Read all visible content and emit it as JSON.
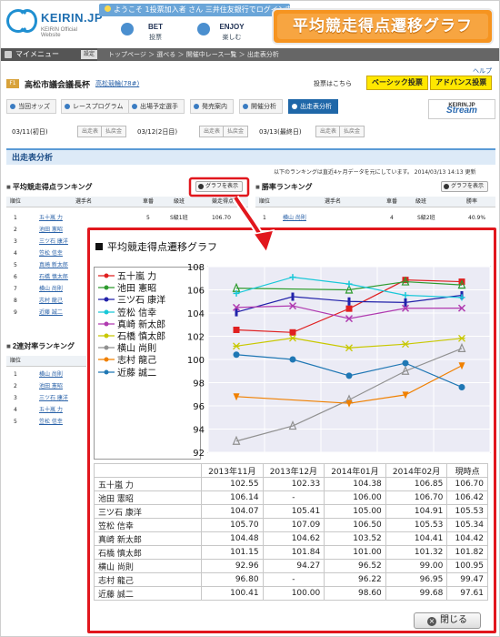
{
  "header": {
    "logo_text": "KEIRIN.JP",
    "logo_sub": "KEIRIN Official Website",
    "welcome": "ようこそ 1投票加入者 さん 三井住友銀行でログイン中",
    "nav": [
      {
        "t1": "BET",
        "t2": "投票"
      },
      {
        "t1": "ENJOY",
        "t2": "楽しむ"
      }
    ],
    "badge": "平均競走得点遷移グラフ"
  },
  "menubar": {
    "mypage": "マイメニュー",
    "settings": "設定",
    "breadcrumb": "トップページ ＞ 選べる ＞ 開催中レース一覧 ＞ 出走表分析"
  },
  "venue": {
    "name": "高松市議会議長杯",
    "trophy": "高松競輪(78#)",
    "help": "ヘルプ",
    "vote_label": "投票はこちら",
    "basic_vote": "ベーシック投票",
    "advance_vote": "アドバンス投票"
  },
  "tabs": [
    "当回オッズ",
    "レースプログラム",
    "出場予定選手",
    "発売案内",
    "開催分析",
    "出走表分析"
  ],
  "stream": {
    "top": "KEIRIN.JP",
    "label": "Stream"
  },
  "dates": [
    {
      "label": "03/11(初日)",
      "b1": "出走表",
      "b2": "払戻金"
    },
    {
      "label": "03/12(2日目)",
      "b1": "出走表",
      "b2": "払戻金"
    },
    {
      "label": "03/13(最終日)",
      "b1": "出走表",
      "b2": "払戻金"
    }
  ],
  "section_title": "出走表分析",
  "info_text": "以下のランキングは直近4ヶ月データを元にしています。 2014/03/13 14:13 更新",
  "ranking_avg": {
    "title": "平均競走得点ランキング",
    "graph_btn": "グラフを表示",
    "headers": [
      "順位",
      "選手名",
      "車番",
      "級班",
      "競走得点"
    ],
    "row1": {
      "rank": "1",
      "name": "五十嵐 力",
      "car": "5",
      "cls": "S級1班",
      "score": "106.70"
    },
    "names": [
      "池田 憲昭",
      "三ツ石 康洋",
      "笠松 信幸",
      "真崎 新太郎",
      "石橋 慎太郎",
      "横山 尚則",
      "志村 龍己",
      "近藤 誠二"
    ],
    "ranks": [
      "2",
      "3",
      "4",
      "5",
      "6",
      "7",
      "8",
      "9"
    ]
  },
  "ranking_win": {
    "title": "勝率ランキング",
    "graph_btn": "グラフを表示",
    "headers": [
      "順位",
      "選手名",
      "車番",
      "級班",
      "勝率"
    ],
    "row1": {
      "rank": "1",
      "name": "横山 尚則",
      "car": "4",
      "cls": "S級2班",
      "rate": "40.9%"
    }
  },
  "ranking_quinella": {
    "title": "2連対率ランキング",
    "names": [
      "横山 尚則",
      "池田 憲昭",
      "三ツ石 康洋",
      "五十嵐 力",
      "笠松 信幸"
    ],
    "ranks": [
      "1",
      "2",
      "3",
      "4",
      "5"
    ]
  },
  "popup": {
    "title": "平均競走得点遷移グラフ",
    "close": "閉じる"
  },
  "chart_data": {
    "type": "line",
    "title": "平均競走得点遷移グラフ",
    "categories": [
      "2013年11月",
      "2013年12月",
      "2014年01月",
      "2014年02月",
      "現時点"
    ],
    "ylim": [
      92,
      108
    ],
    "yticks": [
      92,
      94,
      96,
      98,
      100,
      102,
      104,
      106,
      108
    ],
    "grid": true,
    "legend": "left",
    "series": [
      {
        "name": "五十嵐 力",
        "color": "#e02020",
        "marker": "square",
        "values": [
          102.55,
          102.33,
          104.38,
          106.85,
          106.7
        ],
        "labels": [
          "102.55",
          "102.33",
          "104.38",
          "106.85",
          "106.70"
        ]
      },
      {
        "name": "池田 憲昭",
        "color": "#2e9b2e",
        "marker": "triangle",
        "values": [
          106.14,
          null,
          106.0,
          106.7,
          106.42
        ],
        "labels": [
          "106.14",
          "-",
          "106.00",
          "106.70",
          "106.42"
        ]
      },
      {
        "name": "三ツ石 康洋",
        "color": "#2222aa",
        "marker": "bar",
        "values": [
          104.07,
          105.41,
          105.0,
          104.91,
          105.53
        ],
        "labels": [
          "104.07",
          "105.41",
          "105.00",
          "104.91",
          "105.53"
        ]
      },
      {
        "name": "笠松 信幸",
        "color": "#18c8d8",
        "marker": "plus",
        "values": [
          105.7,
          107.09,
          106.5,
          105.53,
          105.34
        ],
        "labels": [
          "105.70",
          "107.09",
          "106.50",
          "105.53",
          "105.34"
        ]
      },
      {
        "name": "真崎 新太郎",
        "color": "#b03ab0",
        "marker": "x",
        "values": [
          104.48,
          104.62,
          103.52,
          104.41,
          104.42
        ],
        "labels": [
          "104.48",
          "104.62",
          "103.52",
          "104.41",
          "104.42"
        ]
      },
      {
        "name": "石橋 慎太郎",
        "color": "#c8c800",
        "marker": "asterisk",
        "values": [
          101.15,
          101.84,
          101.0,
          101.32,
          101.82
        ],
        "labels": [
          "101.15",
          "101.84",
          "101.00",
          "101.32",
          "101.82"
        ]
      },
      {
        "name": "横山 尚則",
        "color": "#909090",
        "marker": "triangle",
        "values": [
          92.96,
          94.27,
          96.52,
          99.0,
          100.95
        ],
        "labels": [
          "92.96",
          "94.27",
          "96.52",
          "99.00",
          "100.95"
        ]
      },
      {
        "name": "志村 龍己",
        "color": "#f08000",
        "marker": "tri-down",
        "values": [
          96.8,
          null,
          96.22,
          96.95,
          99.47
        ],
        "labels": [
          "96.80",
          "-",
          "96.22",
          "96.95",
          "99.47"
        ]
      },
      {
        "name": "近藤 誠二",
        "color": "#1f77b4",
        "marker": "circle",
        "values": [
          100.41,
          100.0,
          98.6,
          99.68,
          97.61
        ],
        "labels": [
          "100.41",
          "100.00",
          "98.60",
          "99.68",
          "97.61"
        ]
      }
    ]
  }
}
